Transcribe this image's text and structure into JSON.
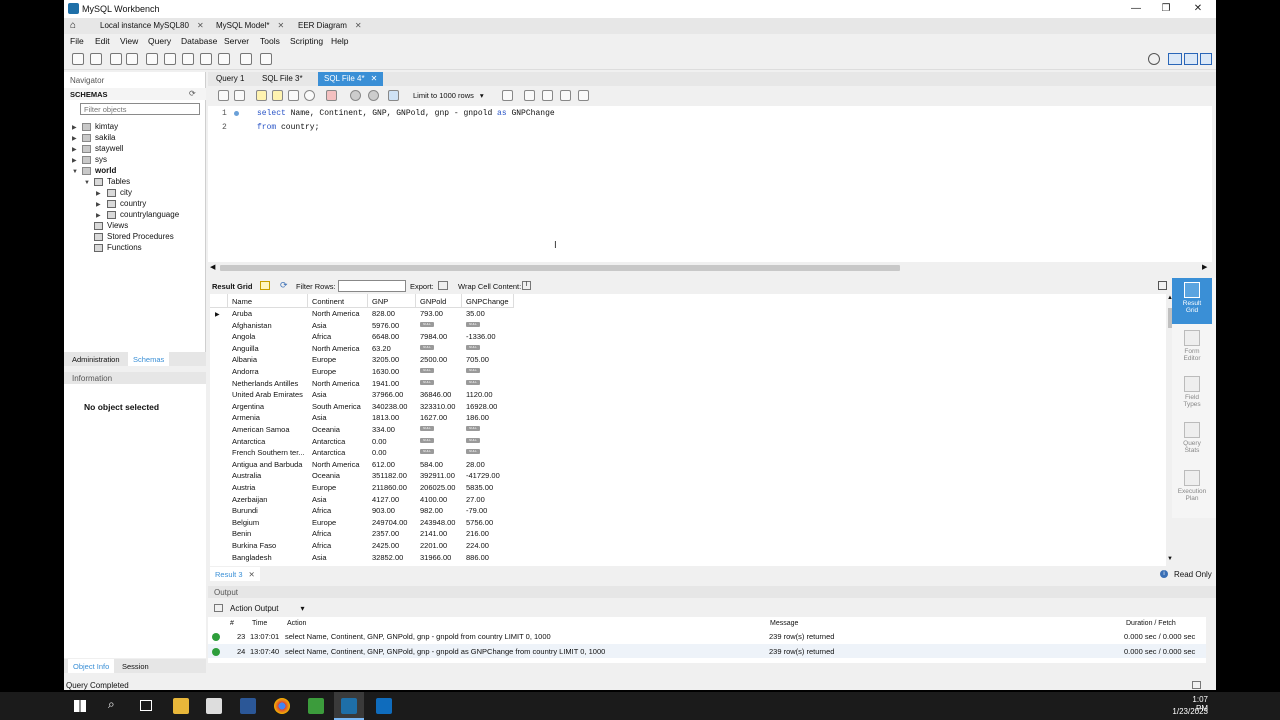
{
  "window": {
    "title": "MySQL Workbench"
  },
  "window_buttons": [
    "—",
    "❐",
    "✕"
  ],
  "doc_tabs": [
    {
      "label": "Local instance MySQL80"
    },
    {
      "label": "MySQL Model*"
    },
    {
      "label": "EER Diagram"
    }
  ],
  "menu": [
    "File",
    "Edit",
    "View",
    "Query",
    "Database",
    "Server",
    "Tools",
    "Scripting",
    "Help"
  ],
  "navigator": {
    "title": "Navigator",
    "schemas_label": "SCHEMAS",
    "filter_placeholder": "Filter objects",
    "schemas": [
      "kimtay",
      "sakila",
      "staywell",
      "sys",
      "world"
    ],
    "tables_label": "Tables",
    "tables": [
      "city",
      "country",
      "countrylanguage"
    ],
    "nodes": [
      "Views",
      "Stored Procedures",
      "Functions"
    ],
    "tabs": [
      "Administration",
      "Schemas"
    ],
    "information_label": "Information",
    "no_object": "No object selected",
    "bottom_tabs": [
      "Object Info",
      "Session"
    ]
  },
  "query_tabs": [
    "Query 1",
    "SQL File 3*",
    "SQL File 4*"
  ],
  "sql_toolbar": {
    "limit": "Limit to 1000 rows"
  },
  "editor": {
    "line_numbers": [
      "1",
      "2"
    ],
    "line1_kw1": "select",
    "line1_rest": " Name, Continent, GNP, GNPold, gnp - gnpold ",
    "line1_kw2": "as",
    "line1_tail": " GNPChange",
    "line2_kw": "from",
    "line2_rest": " country;"
  },
  "result_bar": {
    "result_grid": "Result Grid",
    "filter_rows": "Filter Rows:",
    "export": "Export:",
    "wrap": "Wrap Cell Content:"
  },
  "grid": {
    "columns": [
      "Name",
      "Continent",
      "GNP",
      "GNPold",
      "GNPChange"
    ],
    "null_label": "NULL",
    "rows": [
      [
        "Aruba",
        "North America",
        "828.00",
        "793.00",
        "35.00"
      ],
      [
        "Afghanistan",
        "Asia",
        "5976.00",
        null,
        null
      ],
      [
        "Angola",
        "Africa",
        "6648.00",
        "7984.00",
        "-1336.00"
      ],
      [
        "Anguilla",
        "North America",
        "63.20",
        null,
        null
      ],
      [
        "Albania",
        "Europe",
        "3205.00",
        "2500.00",
        "705.00"
      ],
      [
        "Andorra",
        "Europe",
        "1630.00",
        null,
        null
      ],
      [
        "Netherlands Antilles",
        "North America",
        "1941.00",
        null,
        null
      ],
      [
        "United Arab Emirates",
        "Asia",
        "37966.00",
        "36846.00",
        "1120.00"
      ],
      [
        "Argentina",
        "South America",
        "340238.00",
        "323310.00",
        "16928.00"
      ],
      [
        "Armenia",
        "Asia",
        "1813.00",
        "1627.00",
        "186.00"
      ],
      [
        "American Samoa",
        "Oceania",
        "334.00",
        null,
        null
      ],
      [
        "Antarctica",
        "Antarctica",
        "0.00",
        null,
        null
      ],
      [
        "French Southern ter...",
        "Antarctica",
        "0.00",
        null,
        null
      ],
      [
        "Antigua and Barbuda",
        "North America",
        "612.00",
        "584.00",
        "28.00"
      ],
      [
        "Australia",
        "Oceania",
        "351182.00",
        "392911.00",
        "-41729.00"
      ],
      [
        "Austria",
        "Europe",
        "211860.00",
        "206025.00",
        "5835.00"
      ],
      [
        "Azerbaijan",
        "Asia",
        "4127.00",
        "4100.00",
        "27.00"
      ],
      [
        "Burundi",
        "Africa",
        "903.00",
        "982.00",
        "-79.00"
      ],
      [
        "Belgium",
        "Europe",
        "249704.00",
        "243948.00",
        "5756.00"
      ],
      [
        "Benin",
        "Africa",
        "2357.00",
        "2141.00",
        "216.00"
      ],
      [
        "Burkina Faso",
        "Africa",
        "2425.00",
        "2201.00",
        "224.00"
      ],
      [
        "Bangladesh",
        "Asia",
        "32852.00",
        "31966.00",
        "886.00"
      ]
    ]
  },
  "side_panel": [
    {
      "label": "Result\nGrid"
    },
    {
      "label": "Form\nEditor"
    },
    {
      "label": "Field\nTypes"
    },
    {
      "label": "Query\nStats"
    },
    {
      "label": "Execution\nPlan"
    }
  ],
  "result_tab": "Result 3",
  "read_only": "Read Only",
  "output": {
    "title": "Output",
    "mode": "Action Output",
    "headers": [
      "#",
      "Time",
      "Action",
      "Message",
      "Duration / Fetch"
    ],
    "rows": [
      {
        "num": "23",
        "time": "13:07:01",
        "action": "select Name, Continent, GNP, GNPold, gnp - gnpold from country LIMIT 0, 1000",
        "message": "239 row(s) returned",
        "duration": "0.000 sec / 0.000 sec"
      },
      {
        "num": "24",
        "time": "13:07:40",
        "action": "select Name, Continent, GNP, GNPold, gnp - gnpold as GNPChange from country LIMIT 0, 1000",
        "message": "239 row(s) returned",
        "duration": "0.000 sec / 0.000 sec"
      }
    ]
  },
  "status": "Query Completed",
  "taskbar": {
    "time": "1:07 PM",
    "date": "1/23/2023"
  },
  "colors": {
    "accent": "#3a8fd6",
    "keyword": "#2a55c7",
    "ok": "#2e9e3b"
  }
}
